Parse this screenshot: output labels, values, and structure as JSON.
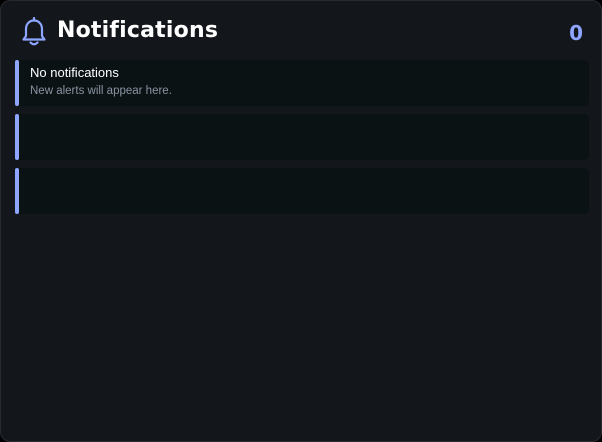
{
  "header": {
    "title": "Notifications",
    "icon": "bell-icon",
    "count": "0"
  },
  "colors": {
    "accent": "#8ea6ff",
    "panel_bg": "#13161b",
    "card_bg": "#0b1214"
  },
  "notifications": [
    {
      "title": "No notifications",
      "subtitle": "New alerts will appear here."
    },
    {
      "title": "",
      "subtitle": ""
    },
    {
      "title": "",
      "subtitle": ""
    }
  ]
}
